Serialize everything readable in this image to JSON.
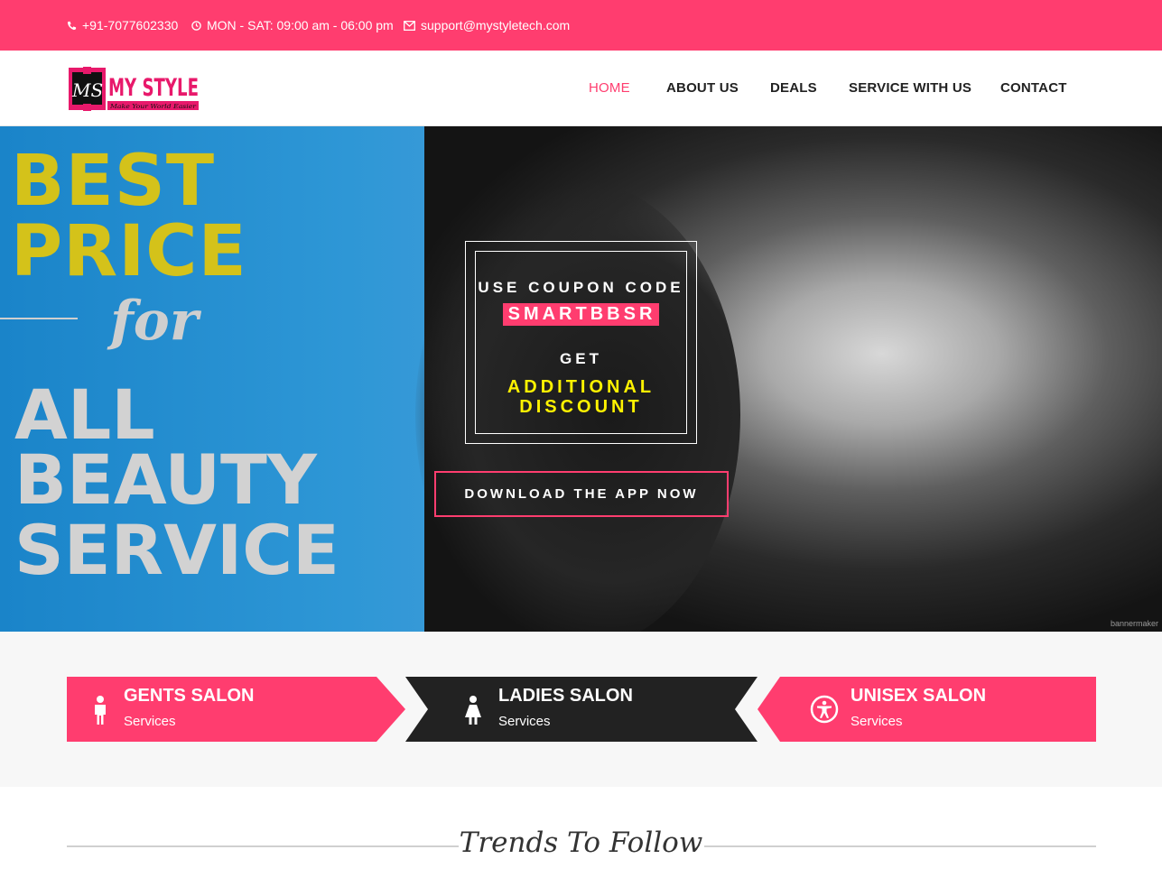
{
  "topbar": {
    "phone": "+91-7077602330",
    "hours": "MON - SAT: 09:00 am - 06:00 pm",
    "email": "support@mystyletech.com",
    "bg_color": "#ff3d6f"
  },
  "header": {
    "logo": {
      "initials": "MS",
      "brand": "MY STYLE",
      "tagline": "Make Your World Easier"
    },
    "nav": [
      "HOME",
      "ABOUT US",
      "DEALS",
      "SERVICE WITH US",
      "CONTACT"
    ],
    "active_nav": "HOME"
  },
  "hero": {
    "banner": {
      "line1": "BEST",
      "line2": "PRICE",
      "line3": "for",
      "line4": "ALL",
      "line5": "BEAUTY",
      "line6": "SERVICE"
    },
    "coupon": {
      "line1": "USE COUPON CODE",
      "code": "SMARTBBSR",
      "line3": "GET",
      "line4": "ADDITIONAL",
      "line5": "DISCOUNT"
    },
    "cta": "DOWNLOAD THE APP NOW",
    "watermark": "bannermaker"
  },
  "salons": [
    {
      "title": "GENTS SALON",
      "sub": "Services",
      "icon": "male-icon",
      "bg": "#ff3d6f"
    },
    {
      "title": "LADIES SALON",
      "sub": "Services",
      "icon": "female-icon",
      "bg": "#222222"
    },
    {
      "title": "UNISEX SALON",
      "sub": "Services",
      "icon": "accessibility-icon",
      "bg": "#ff3d6f"
    }
  ],
  "trends": {
    "title": "Trends To Follow"
  }
}
